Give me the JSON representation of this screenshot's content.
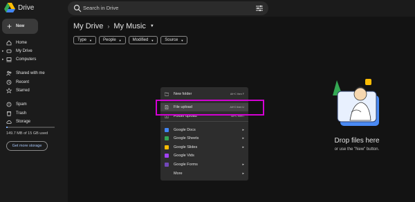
{
  "app": {
    "name": "Drive"
  },
  "search": {
    "placeholder": "Search in Drive"
  },
  "sidebar": {
    "new_label": "New",
    "items": [
      {
        "label": "Home",
        "icon": "home-icon"
      },
      {
        "label": "My Drive",
        "icon": "drive-icon"
      },
      {
        "label": "Computers",
        "icon": "computer-icon"
      },
      {
        "label": "Shared with me",
        "icon": "people-icon"
      },
      {
        "label": "Recent",
        "icon": "clock-icon"
      },
      {
        "label": "Starred",
        "icon": "star-icon"
      },
      {
        "label": "Spam",
        "icon": "spam-icon"
      },
      {
        "label": "Trash",
        "icon": "trash-icon"
      },
      {
        "label": "Storage",
        "icon": "cloud-icon"
      }
    ],
    "storage_text": "149.7 MB of 15 GB used",
    "storage_fraction": 0.01,
    "get_more_label": "Get more storage"
  },
  "breadcrumb": {
    "root": "My Drive",
    "current": "My Music"
  },
  "filters": [
    "Type",
    "People",
    "Modified",
    "Source"
  ],
  "menu": {
    "items": [
      {
        "label": "New folder",
        "shortcut": "Alt+C then F",
        "icon": "new-folder-icon",
        "color": "#9aa0a6"
      },
      {
        "label": "File upload",
        "shortcut": "Alt+C then U",
        "icon": "file-upload-icon",
        "color": "#9aa0a6"
      },
      {
        "label": "Folder upload",
        "shortcut": "Alt+C then I",
        "icon": "folder-upload-icon",
        "color": "#9aa0a6"
      },
      {
        "label": "Google Docs",
        "icon": "docs-icon",
        "color": "#4285f4"
      },
      {
        "label": "Google Sheets",
        "icon": "sheets-icon",
        "color": "#34a853"
      },
      {
        "label": "Google Slides",
        "icon": "slides-icon",
        "color": "#fbbc04"
      },
      {
        "label": "Google Vids",
        "icon": "vids-icon",
        "color": "#a142f4"
      },
      {
        "label": "Google Forms",
        "icon": "forms-icon",
        "color": "#7248b9"
      },
      {
        "label": "More",
        "icon": ""
      }
    ]
  },
  "empty_state": {
    "title": "Drop files here",
    "subtitle": "or use the \"New\" button."
  },
  "colors": {
    "highlight": "#d400d4",
    "accent": "#a8c7fa"
  }
}
